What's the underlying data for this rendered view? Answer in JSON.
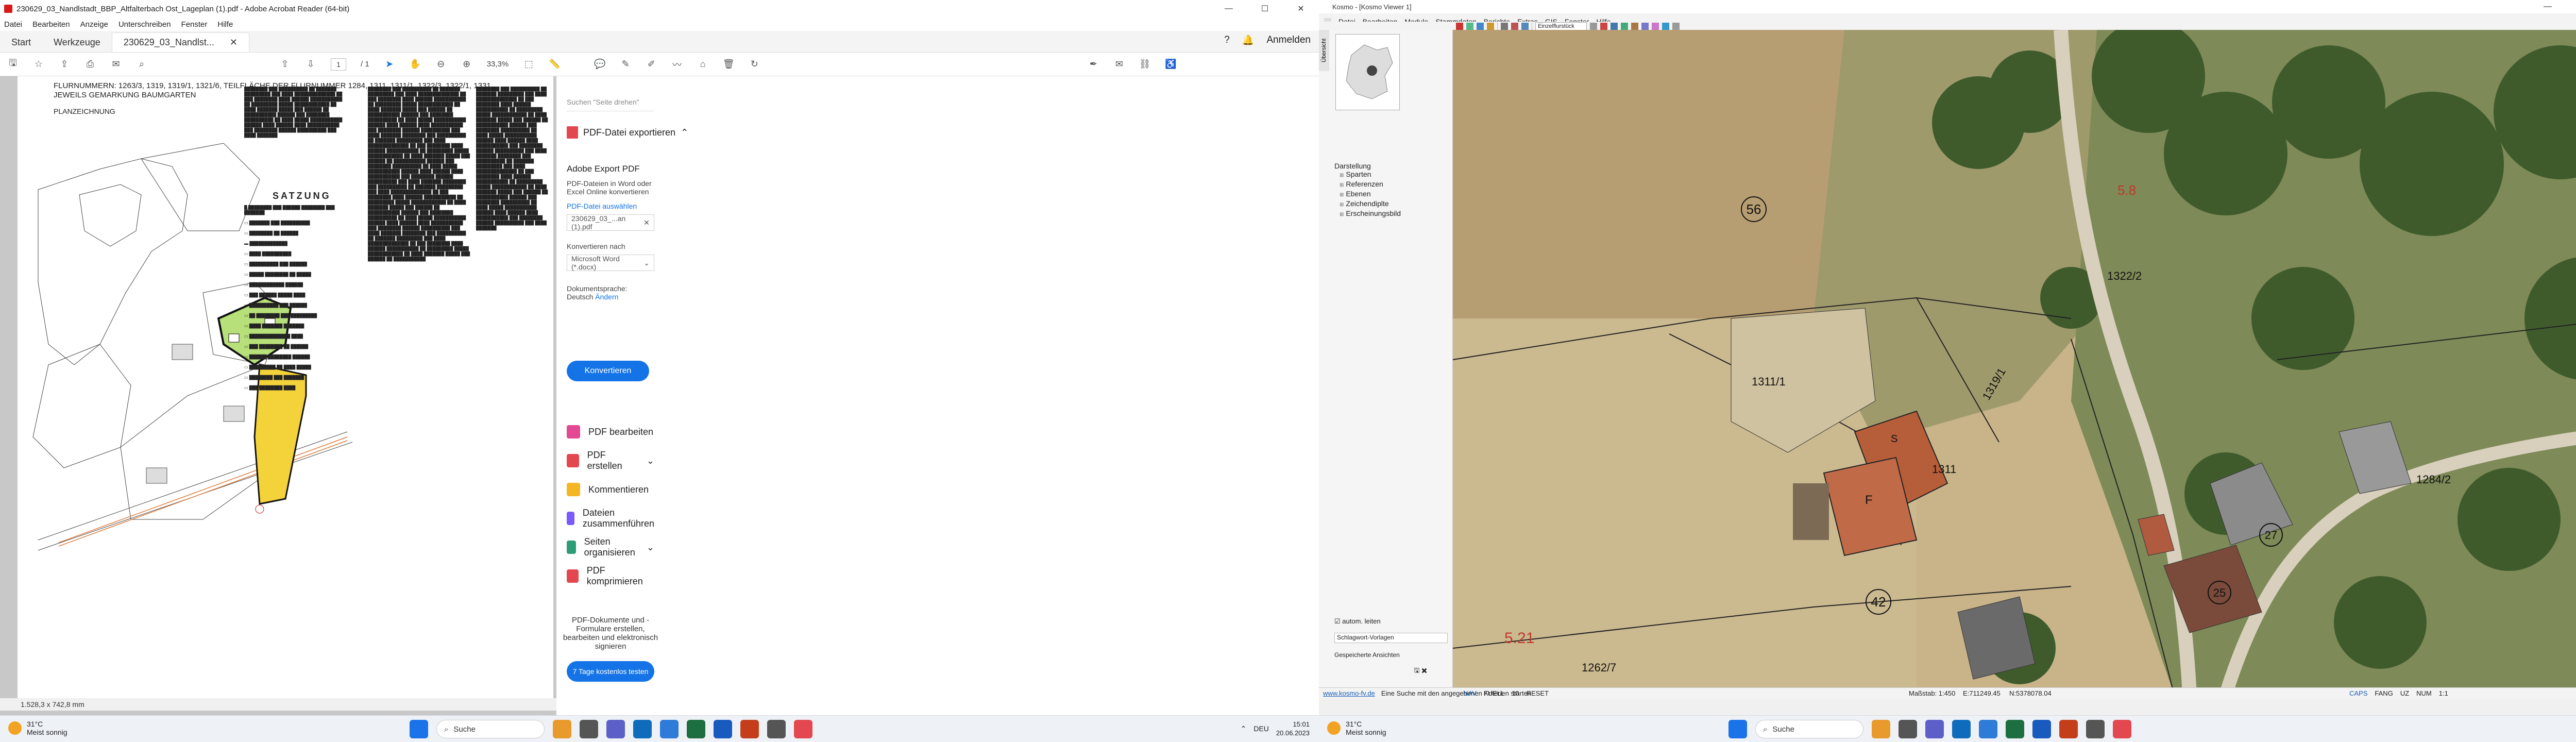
{
  "acrobat": {
    "title": "230629_03_Nandlstadt_BBP_Altfalterbach Ost_Lageplan (1).pdf - Adobe Acrobat Reader (64-bit)",
    "menu": [
      "Datei",
      "Bearbeiten",
      "Anzeige",
      "Unterschreiben",
      "Fenster",
      "Hilfe"
    ],
    "tabs": {
      "start": "Start",
      "werkzeuge": "Werkzeuge",
      "doc": "230629_03_Nandlst..."
    },
    "anmelden": "Anmelden",
    "page_current": "1",
    "page_total": "/ 1",
    "zoom": "33,3%",
    "page_size": "1.528,3 x 742,8 mm",
    "doc": {
      "title_line1": "FLURNUMMERN: 1263/3, 1319, 1319/1, 1321/6, TEILFLÄCHE DER FLURNUMMER 1284, 1311, 1311/1, 1322/3, 1322/1, 1331,",
      "title_line2": "JEWEILS GEMARKUNG BAUMGARTEN",
      "planzeichnung": "PLANZEICHNUNG",
      "satzung": "SATZUNG"
    },
    "search_placeholder": "Suchen \"Seite drehen\"",
    "export": {
      "head": "PDF-Datei exportieren",
      "title": "Adobe Export PDF",
      "desc": "PDF-Dateien in Word oder Excel Online konvertieren",
      "select_label": "PDF-Datei auswählen",
      "file": "230629_03_...an (1).pdf",
      "convert_to": "Konvertieren nach",
      "format": "Microsoft Word (*.docx)",
      "lang_label": "Dokumentsprache:",
      "lang": "Deutsch",
      "lang_change": "Ändern",
      "button": "Konvertieren"
    },
    "tools": [
      "PDF bearbeiten",
      "PDF erstellen",
      "Kommentieren",
      "Dateien zusammenführen",
      "Seiten organisieren",
      "PDF komprimieren"
    ],
    "promo": "PDF-Dokumente und -Formulare erstellen, bearbeiten und elektronisch signieren",
    "promo_button": "7 Tage kostenlos testen"
  },
  "kosmo": {
    "title": "Kosmo - [Kosmo Viewer 1]",
    "menu": [
      "Datei",
      "Bearbeiten",
      "Module",
      "Stammdaten",
      "Berichte",
      "Extras",
      "GIS",
      "Fenster",
      "Hilfe"
    ],
    "combo": "Einzelflurstück",
    "vtab": "Übersicht",
    "tree_title": "Darstellung",
    "tree": [
      "Sparten",
      "Referenzen",
      "Ebenen",
      "Zeichendiplte",
      "Erscheinungsbild"
    ],
    "autofocus": "autom. leiten",
    "template": "Schlagwort-Vorlagen",
    "saved": "Gespeicherte Ansichten",
    "status_link": "www.kosmo-fv.de",
    "status_msg": "Eine Suche mit den angegebenen Kriterien starten",
    "status_left": [
      "NAV",
      "FUELL",
      "10",
      "RESET"
    ],
    "scale_label": "Maßstab: 1:450",
    "coord_e": "E:711249.45",
    "coord_n": "N:5378078.04",
    "status_right": [
      "CAPS",
      "FANG",
      "UZ",
      "NUM",
      "1:1"
    ],
    "map_labels": [
      "56",
      "5.8",
      "1322/2",
      "1311/1",
      "1319/1",
      "S",
      "1311",
      "F",
      "1284/2",
      "42",
      "27",
      "25",
      "5.21",
      "1262/7"
    ]
  },
  "taskbar": {
    "temp": "31°C",
    "weather": "Meist sonnig",
    "search": "Suche",
    "lang": "DEU",
    "time": "15:01",
    "date": "20.06.2023"
  }
}
